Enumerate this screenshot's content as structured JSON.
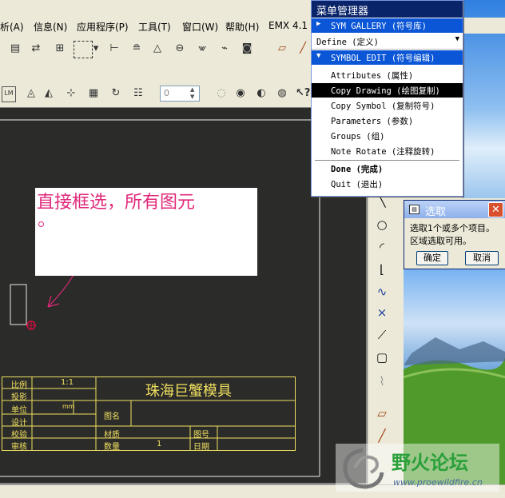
{
  "menubar": {
    "items": [
      "析(A)",
      "信息(N)",
      "应用程序(P)",
      "工具(T)",
      "窗口(W)",
      "帮助(H)",
      "EMX 4.1"
    ]
  },
  "menu_manager": {
    "title": "菜单管理器",
    "sym_gallery": "SYM GALLERY (符号库)",
    "define": "Define (定义)",
    "symbol_edit": "SYMBOL EDIT (符号编辑)",
    "items": [
      "Attributes (属性)",
      "Copy Drawing (绘图复制)",
      "Copy Symbol (复制符号)",
      "Parameters (参数)",
      "Groups (组)",
      "Note Rotate (注释旋转)"
    ],
    "done": "Done (完成)",
    "quit": "Quit (退出)"
  },
  "select_dialog": {
    "title": "选取",
    "line1": "选取1个或多个项目。",
    "line2": "区域选取可用。",
    "ok": "确定",
    "cancel": "取消"
  },
  "toolbar": {
    "spin_value": "0"
  },
  "annotation": {
    "text": "直接框选，所有图元"
  },
  "title_block": {
    "scale_label": "比例",
    "scale_value": "1:1",
    "projection_label": "投影",
    "unit_label": "单位",
    "unit_value": "mm",
    "design_label": "设计",
    "check_label": "校验",
    "review_label": "审核",
    "company": "珠海巨蟹模具",
    "drawing_name_label": "图名",
    "material_label": "材质",
    "quantity_label": "数量",
    "quantity_value": "1",
    "drawing_no_label": "图号",
    "date_label": "日期"
  },
  "watermark": {
    "text": "野火论坛",
    "url": "www.proewildfire.cn"
  }
}
